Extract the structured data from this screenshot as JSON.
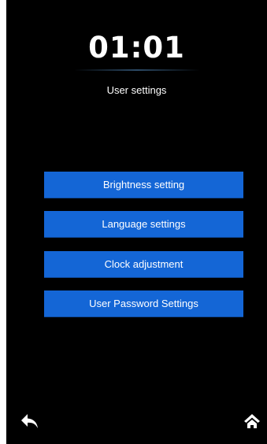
{
  "header": {
    "clock": "01:01",
    "title": "User settings"
  },
  "menu": {
    "items": [
      {
        "label": "Brightness setting"
      },
      {
        "label": "Language settings"
      },
      {
        "label": "Clock adjustment"
      },
      {
        "label": "User Password Settings"
      }
    ]
  },
  "nav": {
    "back_icon": "back-arrow-icon",
    "home_icon": "home-icon"
  },
  "colors": {
    "background": "#000000",
    "button": "#1466d6",
    "text": "#ffffff"
  }
}
